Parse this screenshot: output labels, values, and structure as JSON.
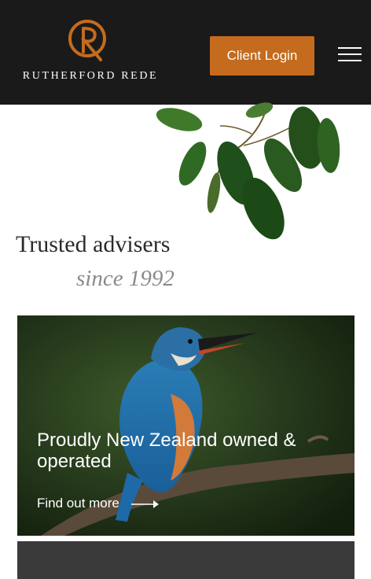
{
  "header": {
    "brand_name": "RUTHERFORD REDE",
    "login_label": "Client Login"
  },
  "hero": {
    "tagline_line1": "Trusted advisers",
    "tagline_line2": "since 1992"
  },
  "feature_card": {
    "title": "Proudly New Zealand owned & operated",
    "link_label": "Find out more"
  },
  "colors": {
    "header_bg": "#1a1a1a",
    "accent": "#c46b1e",
    "text_dark": "#2a2a2a",
    "text_muted": "#8a8a8a"
  },
  "icons": [
    "logo-monogram-icon",
    "hamburger-menu-icon",
    "arrow-right-icon"
  ]
}
